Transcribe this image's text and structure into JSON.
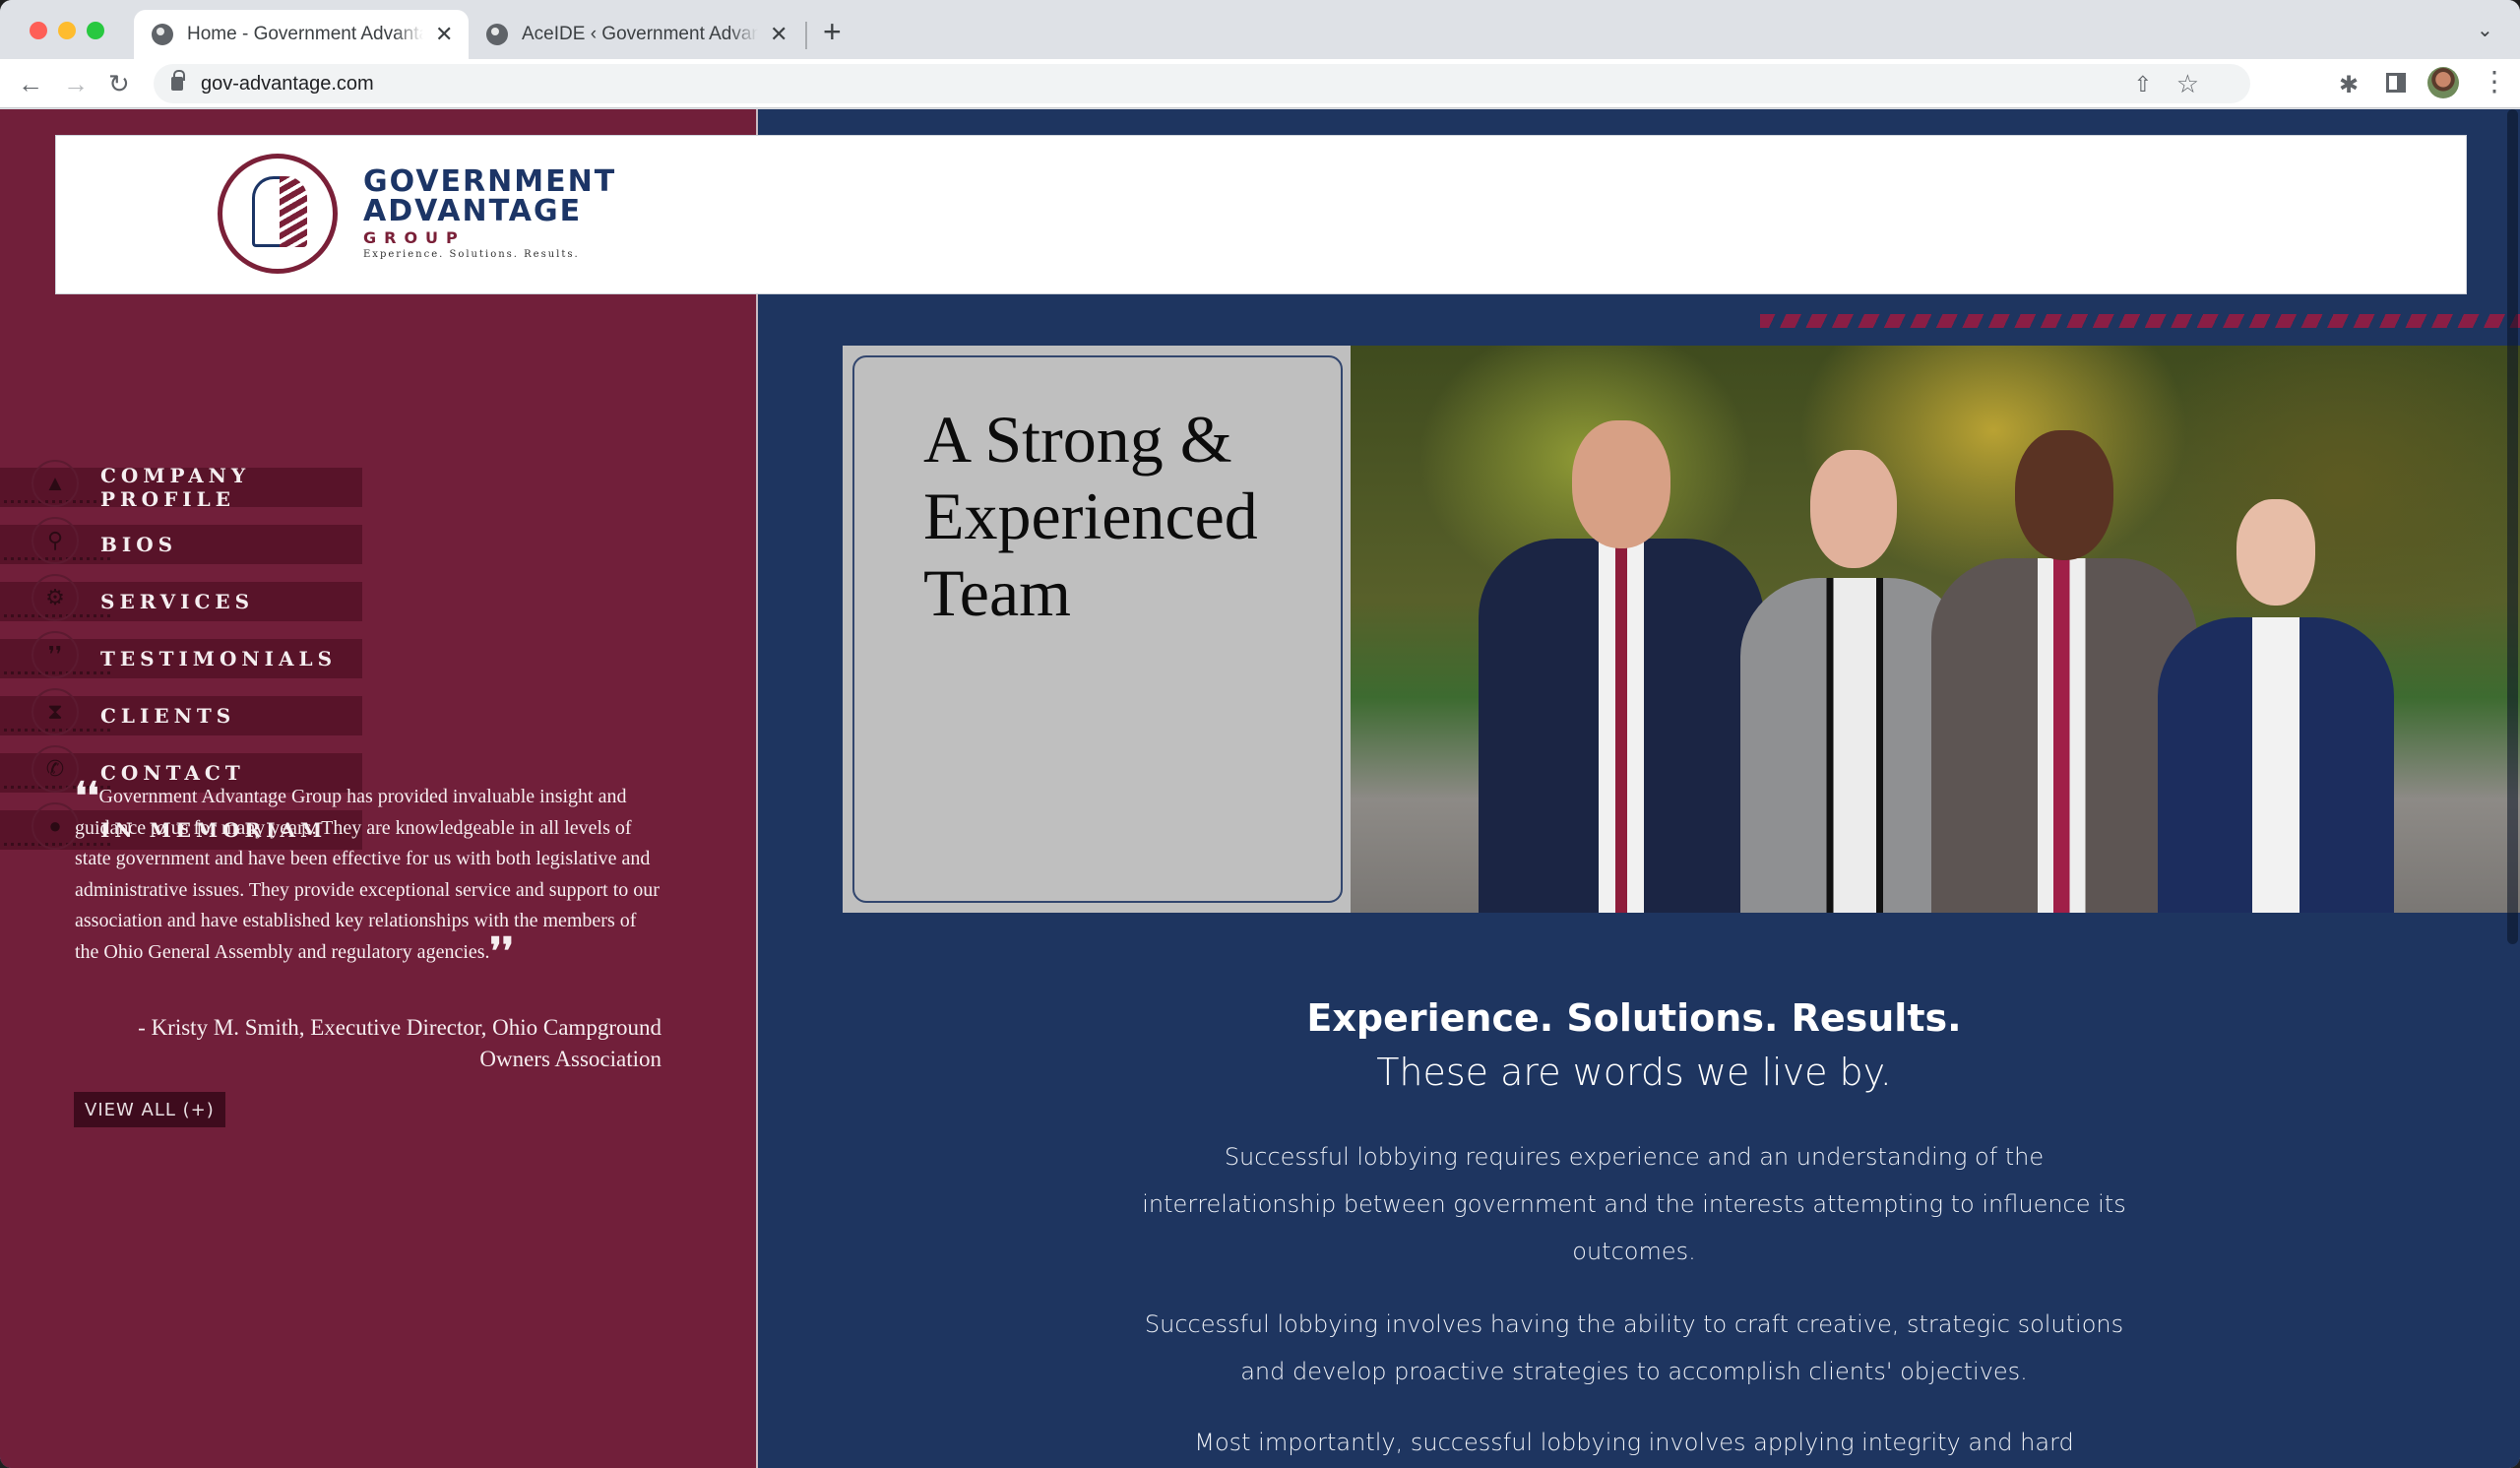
{
  "browser": {
    "tabs": [
      {
        "title": "Home - Government Advantage Group",
        "active": true,
        "icon": "globe-icon"
      },
      {
        "title": "AceIDE ‹ Government Advantage Group",
        "active": false,
        "icon": "globe-icon"
      }
    ],
    "close_glyph": "✕",
    "new_tab_glyph": "+",
    "tab_search_glyph": "⌄",
    "nav": {
      "back": "←",
      "forward": "→",
      "reload": "↻"
    },
    "url": "gov-advantage.com",
    "share_glyph": "⇧",
    "bookmark_glyph": "☆",
    "extensions_glyph": "✱",
    "menu_glyph": "⋮"
  },
  "header": {
    "logo": {
      "line1": "GOVERNMENT",
      "line2": "ADVANTAGE",
      "line3": "GROUP",
      "tagline": "Experience. Solutions. Results."
    }
  },
  "sidebar": {
    "nav": [
      {
        "label": "COMPANY PROFILE",
        "icon": "capitol-dome-icon",
        "glyph": "▲"
      },
      {
        "label": "BIOS",
        "icon": "magnifier-icon",
        "glyph": "⚲"
      },
      {
        "label": "SERVICES",
        "icon": "gear-icon",
        "glyph": "⚙"
      },
      {
        "label": "TESTIMONIALS",
        "icon": "quote-icon",
        "glyph": "❜❜"
      },
      {
        "label": "CLIENTS",
        "icon": "hourglass-icon",
        "glyph": "⧗"
      },
      {
        "label": "CONTACT",
        "icon": "phone-icon",
        "glyph": "✆"
      },
      {
        "label": "IN MEMORIAM",
        "icon": "circle-icon",
        "glyph": "●"
      }
    ],
    "testimonial": {
      "open_quote": "❛❛",
      "text": "Government Advantage Group has provided invaluable insight and guidance to us for many years. They are knowledgeable in all levels of state government and have been effective for us with both legislative and administrative issues. They provide exceptional service and support to our association and have established key relationships with the members of the Ohio General Assembly and regulatory agencies.",
      "close_quote": "❜❜",
      "attribution": "- Kristy M. Smith, Executive Director, Ohio Campground Owners Association",
      "view_all_label": "VIEW ALL (+)"
    }
  },
  "hero": {
    "heading_line1": "A Strong &",
    "heading_line2": "Experienced",
    "heading_line3": "Team",
    "photo_alt": "Team photo of four staff members in business attire outdoors"
  },
  "content": {
    "tagline_line1": "Experience.  Solutions.  Results.",
    "tagline_line2": "These are words we live by.",
    "paragraphs": [
      "Successful lobbying requires experience and an understanding of the interrelationship between government and the interests attempting to influence its outcomes.",
      "Successful lobbying involves having the ability to craft creative, strategic solutions and develop proactive strategies to accomplish clients' objectives.",
      "Most importantly, successful lobbying involves applying integrity and hard"
    ]
  },
  "colors": {
    "sidebar_bg": "#711f3a",
    "nav_item_bg": "#581329",
    "main_bg": "#1e3560",
    "brand_navy": "#1c3566",
    "brand_maroon": "#7a2038",
    "hero_card_bg": "#bfbfbf"
  }
}
